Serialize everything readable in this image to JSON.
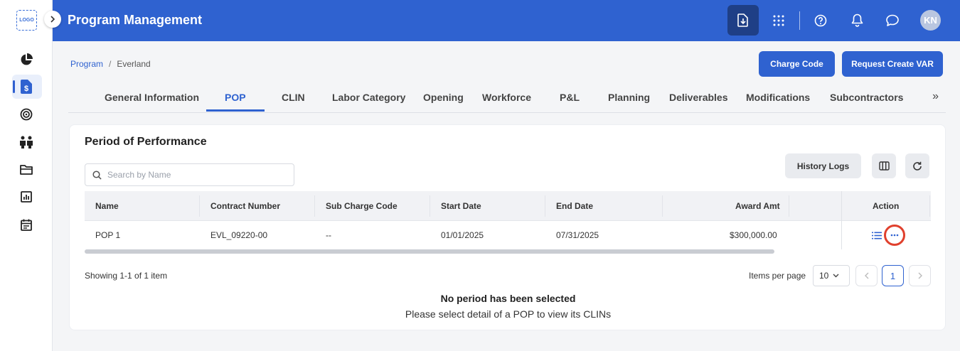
{
  "sidebar": {
    "logo_text": "LOGO",
    "items": [
      {
        "icon": "pie-chart-icon"
      },
      {
        "icon": "dollar-document-icon",
        "active": true
      },
      {
        "icon": "target-icon"
      },
      {
        "icon": "people-icon"
      },
      {
        "icon": "folder-icon"
      },
      {
        "icon": "bar-chart-icon"
      },
      {
        "icon": "calendar-icon"
      }
    ]
  },
  "header": {
    "title": "Program Management",
    "avatar_initials": "KN",
    "accent": "#2f62d0"
  },
  "breadcrumb": {
    "root": "Program",
    "separator": "/",
    "current": "Everland"
  },
  "actions": {
    "charge_code": "Charge Code",
    "request_var": "Request Create VAR"
  },
  "tabs": [
    {
      "label": "General Information"
    },
    {
      "label": "POP",
      "active": true
    },
    {
      "label": "CLIN"
    },
    {
      "label": "Labor Category"
    },
    {
      "label": "Opening"
    },
    {
      "label": "Workforce"
    },
    {
      "label": "P&L"
    },
    {
      "label": "Planning"
    },
    {
      "label": "Deliverables"
    },
    {
      "label": "Modifications"
    },
    {
      "label": "Subcontractors"
    }
  ],
  "tabs_more": "»",
  "section": {
    "title": "Period of Performance",
    "search_placeholder": "Search by Name",
    "history_logs": "History Logs"
  },
  "table": {
    "headers": {
      "name": "Name",
      "contract_number": "Contract Number",
      "sub_charge_code": "Sub Charge Code",
      "start_date": "Start Date",
      "end_date": "End Date",
      "award_amt": "Award Amt",
      "action": "Action"
    },
    "rows": [
      {
        "name": "POP 1",
        "contract_number": "EVL_09220-00",
        "sub_charge_code": "--",
        "start_date": "01/01/2025",
        "end_date": "07/31/2025",
        "award_amt": "$300,000.00"
      }
    ]
  },
  "pagination": {
    "showing": "Showing 1-1 of 1 item",
    "items_per_page_label": "Items per page",
    "items_per_page": "10",
    "current_page": "1"
  },
  "empty_state": {
    "title": "No period has been selected",
    "subtitle": "Please select detail of a POP to view its CLINs"
  }
}
